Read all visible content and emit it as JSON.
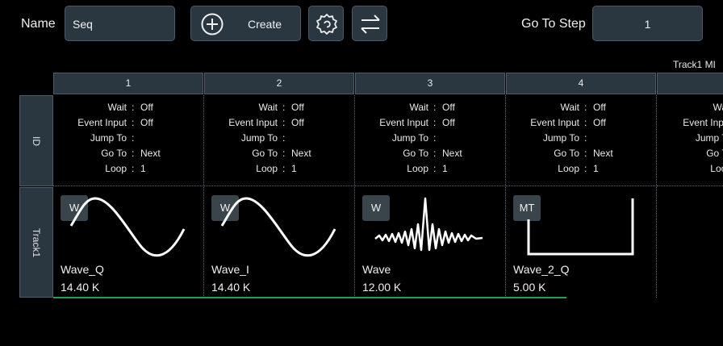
{
  "toolbar": {
    "name_label": "Name",
    "name_value": "Seq",
    "create_label": "Create",
    "goto_label": "Go To Step",
    "goto_value": "1"
  },
  "track_legend": "Track1  MI",
  "rows": {
    "id_label": "ID",
    "track_label": "Track1"
  },
  "info_labels": {
    "wait": "Wait",
    "event": "Event Input",
    "jump": "Jump To",
    "goto": "Go To",
    "loop": "Loop"
  },
  "steps": [
    {
      "number": "1",
      "wait": "Off",
      "event": "Off",
      "jump": "",
      "goto": "Next",
      "loop": "1",
      "badge": "W",
      "wave_name": "Wave_Q",
      "wave_size": "14.40 K",
      "wave_icon": "sine-wave-icon"
    },
    {
      "number": "2",
      "wait": "Off",
      "event": "Off",
      "jump": "",
      "goto": "Next",
      "loop": "1",
      "badge": "W",
      "wave_name": "Wave_I",
      "wave_size": "14.40 K",
      "wave_icon": "sine-wave-icon"
    },
    {
      "number": "3",
      "wait": "Off",
      "event": "Off",
      "jump": "",
      "goto": "Next",
      "loop": "1",
      "badge": "W",
      "wave_name": "Wave",
      "wave_size": "12.00 K",
      "wave_icon": "sinc-wave-icon"
    },
    {
      "number": "4",
      "wait": "Off",
      "event": "Off",
      "jump": "",
      "goto": "Next",
      "loop": "1",
      "badge": "MT",
      "wave_name": "Wave_2_Q",
      "wave_size": "5.00 K",
      "wave_icon": "pulse-wave-icon"
    }
  ],
  "partial_step": {
    "wait": "Wait",
    "event": "Event Input",
    "jump": "Jump To",
    "goto": "Go To",
    "loop": "Loop"
  },
  "colors": {
    "panel": "#2a3640",
    "accent_line": "#1fa05a",
    "background": "#000000"
  }
}
